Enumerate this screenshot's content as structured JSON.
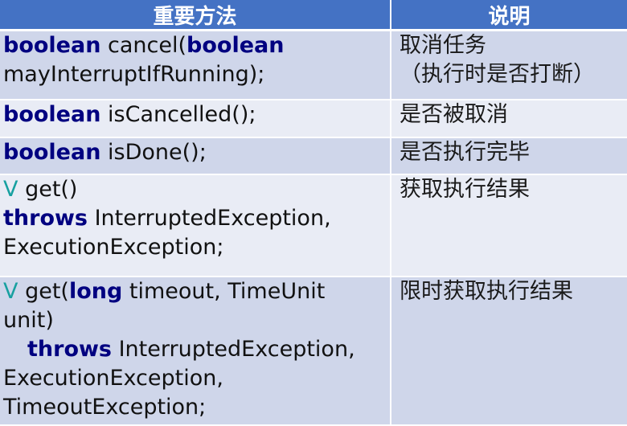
{
  "header": {
    "method": "重要方法",
    "desc": "说明"
  },
  "rows": [
    {
      "lines": [
        {
          "kw1": "boolean",
          "t1": " cancel(",
          "kw2": "boolean"
        },
        {
          "t1": "mayInterruptIfRunning);"
        }
      ],
      "desc": [
        "取消任务",
        "（执行时是否打断）"
      ]
    },
    {
      "lines": [
        {
          "kw1": "boolean",
          "t1": " isCancelled();"
        }
      ],
      "desc": [
        "是否被取消"
      ]
    },
    {
      "lines": [
        {
          "kw1": "boolean",
          "t1": " isDone();"
        }
      ],
      "desc": [
        "是否执行完毕"
      ]
    },
    {
      "lines": [
        {
          "tp": "V",
          "t1": " get()"
        },
        {
          "kw1": "throws",
          "t1": " InterruptedException,"
        },
        {
          "t1": "ExecutionException;"
        }
      ],
      "desc": [
        "获取执行结果"
      ]
    },
    {
      "lines": [
        {
          "tp": "V",
          "t1": " get(",
          "kw2": "long",
          "t2": " timeout, TimeUnit"
        },
        {
          "t1": "unit)"
        },
        {
          "kw1": "throws",
          "t1": " InterruptedException,"
        },
        {
          "t1": "ExecutionException,"
        },
        {
          "t1": "TimeoutException;"
        }
      ],
      "desc": [
        "限时获取执行结果"
      ]
    }
  ]
}
